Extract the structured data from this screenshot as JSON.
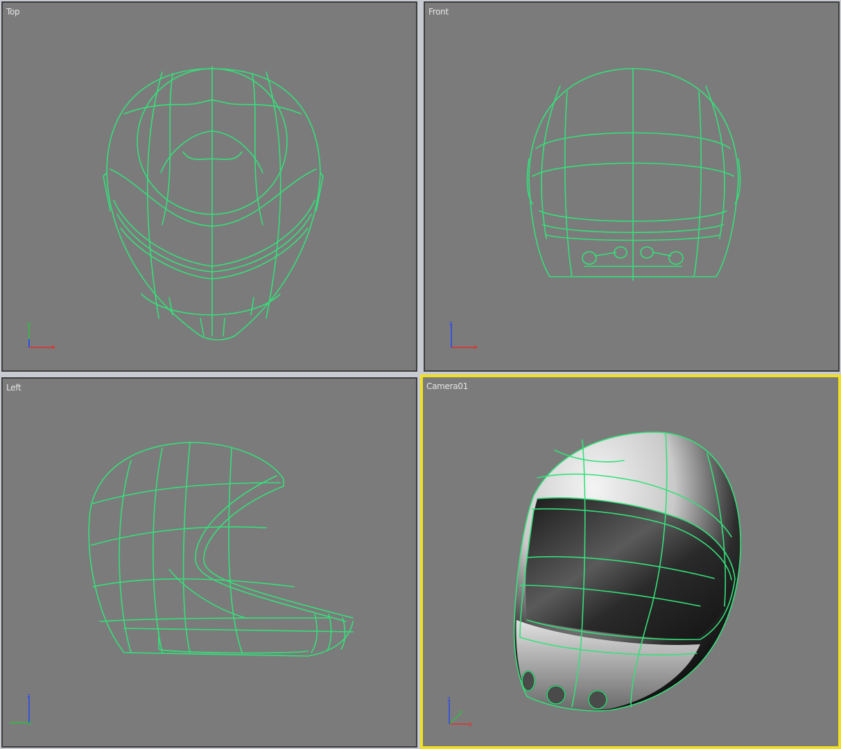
{
  "viewports": {
    "top": {
      "label": "Top"
    },
    "front": {
      "label": "Front"
    },
    "left": {
      "label": "Left"
    },
    "camera": {
      "label": "Camera01",
      "active": true
    }
  },
  "colors": {
    "viewport_bg": "#7b7b7b",
    "wireframe": "#35e07a",
    "active_border": "#f0e020",
    "axis_x": "#e23030",
    "axis_y": "#30c040",
    "axis_z": "#3050e0"
  },
  "icons": {
    "axis_gizmo": "xyz-axis-icon",
    "model": "helmet-wireframe"
  }
}
